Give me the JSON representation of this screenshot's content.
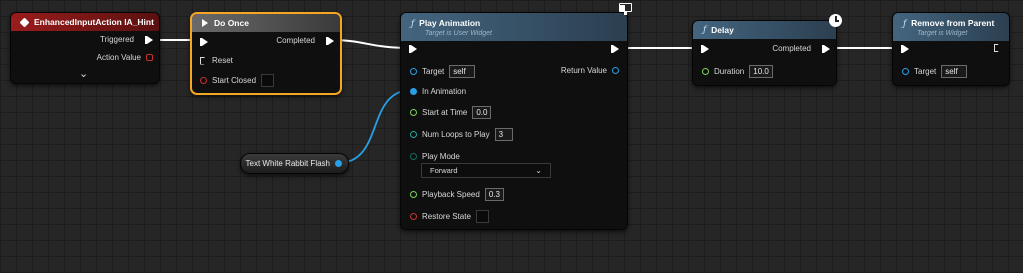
{
  "event_node": {
    "title": "EnhancedInputAction IA_Hint",
    "pins": {
      "triggered": "Triggered",
      "action_value": "Action Value"
    },
    "expand_glyph": "⌄"
  },
  "do_once": {
    "title": "Do Once",
    "pins": {
      "completed": "Completed",
      "reset": "Reset",
      "start_closed": "Start Closed"
    }
  },
  "play_animation": {
    "title": "Play Animation",
    "subtitle": "Target is User Widget",
    "pins": {
      "target": "Target",
      "target_value": "self",
      "return_value": "Return Value",
      "in_animation": "In Animation",
      "start_at_time": "Start at Time",
      "start_at_time_value": "0.0",
      "num_loops": "Num Loops to Play",
      "num_loops_value": "3",
      "play_mode": "Play Mode",
      "play_mode_value": "Forward",
      "playback_speed": "Playback Speed",
      "playback_speed_value": "0.3",
      "restore_state": "Restore State"
    }
  },
  "variable_node": {
    "label": "Text White Rabbit Flash"
  },
  "delay": {
    "title": "Delay",
    "pins": {
      "completed": "Completed",
      "duration": "Duration",
      "duration_value": "10.0"
    }
  },
  "remove_from_parent": {
    "title": "Remove from Parent",
    "subtitle": "Target is Widget",
    "pins": {
      "target": "Target",
      "target_value": "self"
    }
  },
  "colors": {
    "event_header": "#8a1a1a",
    "macro_header": "#5a5a5a",
    "function_header": "#3d5a73",
    "exec": "#ffffff",
    "object_pin": "#2a9fe6",
    "float_pin": "#7ad45a",
    "bool_pin": "#c53232",
    "int_pin": "#1ea89c",
    "selection_outline": "#f5a623"
  }
}
